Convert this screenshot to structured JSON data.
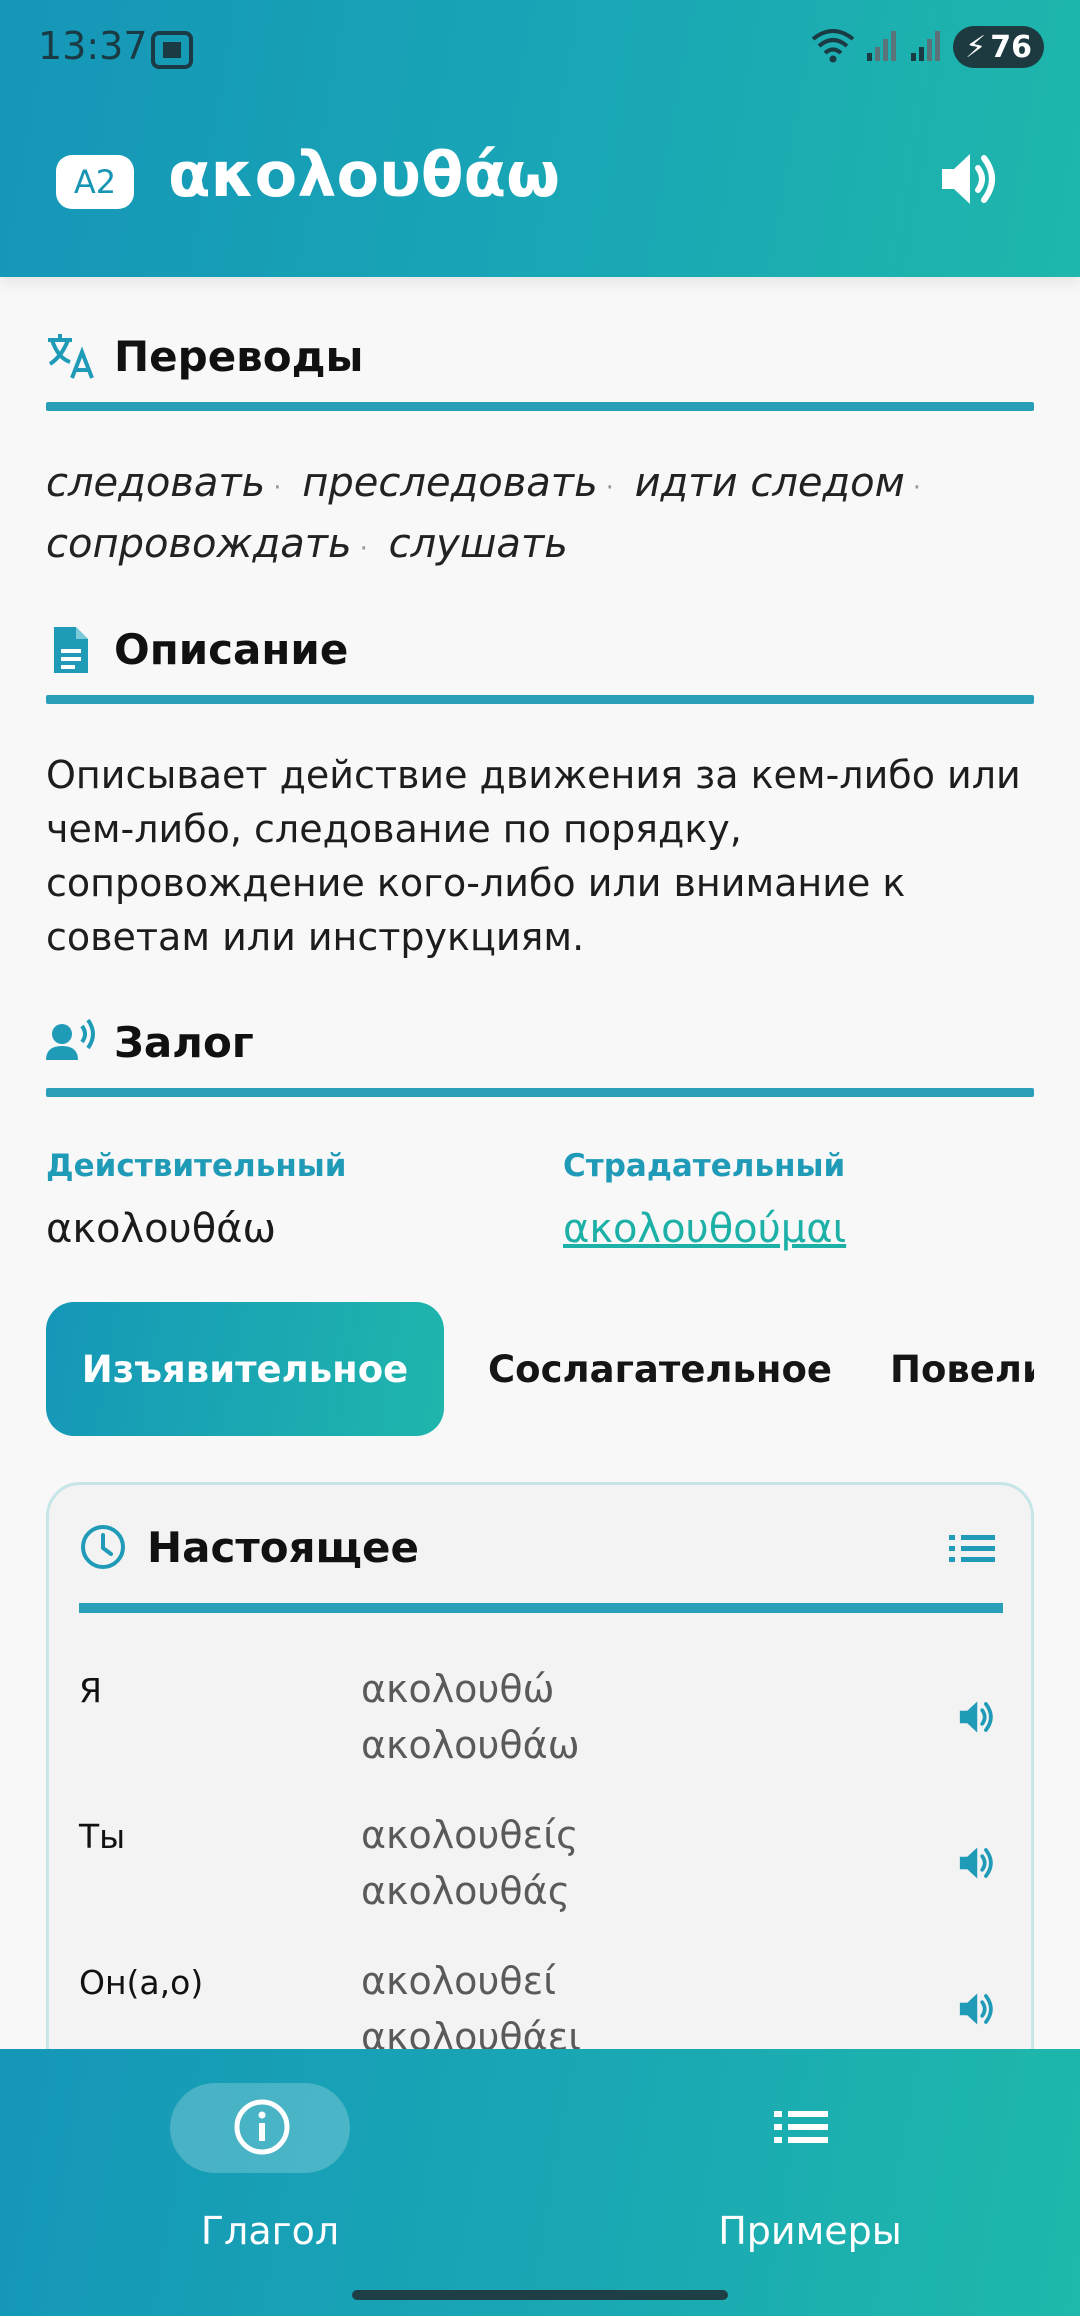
{
  "status_bar": {
    "time": "13:37",
    "battery": "76"
  },
  "header": {
    "level": "A2",
    "word": "ακολουθάω",
    "speaker_icon": "speaker-icon"
  },
  "sections": {
    "translations_title": "Переводы",
    "description_title": "Описание",
    "voice_title": "Залог"
  },
  "translations": [
    "следовать",
    "преследовать",
    "идти следом",
    "сопровождать",
    "слушать"
  ],
  "description": "Описывает действие движения за кем-либо или чем-либо, следование по порядку, сопровождение кого-либо или внимание к советам или инструкциям.",
  "voice": {
    "active_label": "Действительный",
    "active_value": "ακολουθάω",
    "passive_label": "Страдательный",
    "passive_value": "ακολουθούμαι"
  },
  "mood_tabs": [
    {
      "label": "Изъявительное",
      "active": true
    },
    {
      "label": "Сослагательное",
      "active": false
    },
    {
      "label": "Повели",
      "active": false
    }
  ],
  "tense_card": {
    "title": "Настоящее",
    "rows": [
      {
        "pronoun": "Я",
        "form1": "ακολουθώ",
        "form2": "ακολουθάω"
      },
      {
        "pronoun": "Ты",
        "form1": "ακολουθείς",
        "form2": "ακολουθάς"
      },
      {
        "pronoun": "Он(а,о)",
        "form1": "ακολουθεί",
        "form2": "ακολουθάει"
      }
    ]
  },
  "bottom_nav": [
    {
      "label": "Глагол",
      "icon": "info-icon",
      "active": true
    },
    {
      "label": "Примеры",
      "icon": "list-icon",
      "active": false
    }
  ],
  "colors": {
    "accent": "#1f9bb8",
    "accent_alt": "#1fb6ac"
  }
}
